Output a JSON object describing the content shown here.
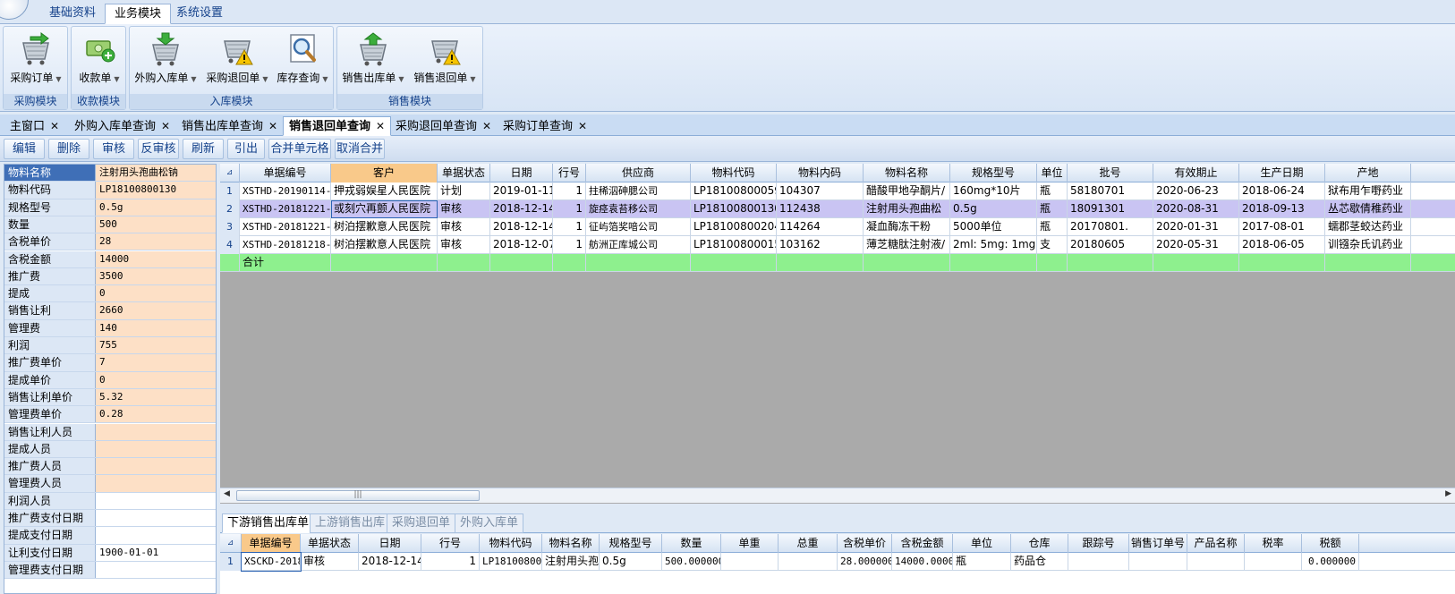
{
  "ribbon_tabs": [
    "基础资料",
    "业务模块",
    "系统设置"
  ],
  "ribbon_active_tab": 1,
  "ribbon_groups": [
    {
      "label": "采购模块",
      "buttons": [
        {
          "label": "采购订单",
          "icon": "cart-arrow-icon"
        }
      ]
    },
    {
      "label": "收款模块",
      "buttons": [
        {
          "label": "收款单",
          "icon": "money-plus-icon"
        }
      ]
    },
    {
      "label": "入库模块",
      "buttons": [
        {
          "label": "外购入库单",
          "icon": "cart-down-icon"
        },
        {
          "label": "采购退回单",
          "icon": "cart-warning-icon"
        },
        {
          "label": "库存查询",
          "icon": "magnifier-icon"
        }
      ]
    },
    {
      "label": "销售模块",
      "buttons": [
        {
          "label": "销售出库单",
          "icon": "cart-up-icon"
        },
        {
          "label": "销售退回单",
          "icon": "cart-warning-icon"
        }
      ]
    }
  ],
  "doc_tabs": [
    "主窗口",
    "外购入库单查询",
    "销售出库单查询",
    "销售退回单查询",
    "采购退回单查询",
    "采购订单查询"
  ],
  "doc_active_tab": 3,
  "toolbar": [
    "编辑",
    "删除",
    "审核",
    "反审核",
    "刷新",
    "引出",
    "合并单元格",
    "取消合并"
  ],
  "side_fields": [
    {
      "key": "物料名称",
      "value": "注射用头孢曲松钠"
    },
    {
      "key": "物料代码",
      "value": "LP18100800130"
    },
    {
      "key": "规格型号",
      "value": "0.5g"
    },
    {
      "key": "数量",
      "value": "500"
    },
    {
      "key": "含税单价",
      "value": "28"
    },
    {
      "key": "含税金额",
      "value": "14000"
    },
    {
      "key": "推广费",
      "value": "3500"
    },
    {
      "key": "提成",
      "value": "0"
    },
    {
      "key": "销售让利",
      "value": "2660"
    },
    {
      "key": "管理费",
      "value": "140"
    },
    {
      "key": "利润",
      "value": "755"
    },
    {
      "key": "推广费单价",
      "value": "7"
    },
    {
      "key": "提成单价",
      "value": "0"
    },
    {
      "key": "销售让利单价",
      "value": "5.32"
    },
    {
      "key": "管理费单价",
      "value": "0.28"
    },
    {
      "key": "销售让利人员",
      "value": ""
    },
    {
      "key": "提成人员",
      "value": ""
    },
    {
      "key": "推广费人员",
      "value": ""
    },
    {
      "key": "管理费人员",
      "value": ""
    },
    {
      "key": "利润人员",
      "value": ""
    },
    {
      "key": "推广费支付日期",
      "value": ""
    },
    {
      "key": "提成支付日期",
      "value": ""
    },
    {
      "key": "让利支付日期",
      "value": "1900-01-01"
    },
    {
      "key": "管理费支付日期",
      "value": ""
    }
  ],
  "main_grid": {
    "corner": "⊿",
    "columns": [
      "单据编号",
      "客户",
      "单据状态",
      "日期",
      "行号",
      "供应商",
      "物料代码",
      "物料内码",
      "物料名称",
      "规格型号",
      "单位",
      "批号",
      "有效期止",
      "生产日期",
      "产地"
    ],
    "rows": [
      [
        "1",
        "XSTHD-20190114-",
        "押戎弱娱星人民医院",
        "计划",
        "2019-01-11",
        "1",
        "拄稀泅砷腮公司",
        "LP18100800059",
        "104307",
        "醋酸甲地孕酮片/",
        "160mg*10片",
        "瓶",
        "58180701",
        "2020-06-23",
        "2018-06-24",
        "狱布用乍嘢药业"
      ],
      [
        "2",
        "XSTHD-20181221-",
        "或刻穴再颤人民医院",
        "审核",
        "2018-12-14",
        "1",
        "旋痉袁苔移公司",
        "LP18100800130",
        "112438",
        "注射用头孢曲松",
        "0.5g",
        "瓶",
        "18091301",
        "2020-08-31",
        "2018-09-13",
        "丛芯歇倩稚药业"
      ],
      [
        "3",
        "XSTHD-20181221-",
        "树泊摆歉意人民医院",
        "审核",
        "2018-12-14",
        "1",
        "征屿箔奖喑公司",
        "LP18100800204",
        "114264",
        "凝血酶冻干粉",
        "5000单位",
        "瓶",
        "20170801.",
        "2020-01-31",
        "2017-08-01",
        "蠕郡茎蛟达药业"
      ],
      [
        "4",
        "XSTHD-20181218-",
        "树泊摆歉意人民医院",
        "审核",
        "2018-12-07",
        "1",
        "舫洲正库城公司",
        "LP18100800015",
        "103162",
        "薄芝糖肽注射液/",
        "2ml: 5mg: 1mg",
        "支",
        "20180605",
        "2020-05-31",
        "2018-06-05",
        "训镪杂氏讥药业"
      ]
    ],
    "total_label": "合计"
  },
  "scrollbar": {
    "grip": "|||",
    "left_arrow": "◀",
    "right_arrow": "▶"
  },
  "bottom_tabs": [
    "下游销售出库单",
    "上游销售出库",
    "采购退回单",
    "外购入库单"
  ],
  "bottom_active_tab": 0,
  "bottom_grid": {
    "corner": "⊿",
    "columns": [
      "单据编号",
      "单据状态",
      "日期",
      "行号",
      "物料代码",
      "物料名称",
      "规格型号",
      "数量",
      "单重",
      "总重",
      "含税单价",
      "含税金额",
      "单位",
      "仓库",
      "跟踪号",
      "销售订单号",
      "产品名称",
      "税率",
      "税额"
    ],
    "rows": [
      [
        "1",
        "XSCKD-2018",
        "审核",
        "2018-12-14",
        "1",
        "LP18100800",
        "注射用头孢",
        "0.5g",
        "500.000000",
        "",
        "",
        "28.000000",
        "14000.0000",
        "瓶",
        "药品仓",
        "",
        "",
        "",
        "",
        "0.000000"
      ]
    ]
  },
  "colors": {
    "selected_row": "#c9c4f3",
    "total_row": "#8ef08e",
    "highlight_header": "#f9c98a",
    "peach": "#fde0c6",
    "ribbon_text": "#15428b"
  }
}
